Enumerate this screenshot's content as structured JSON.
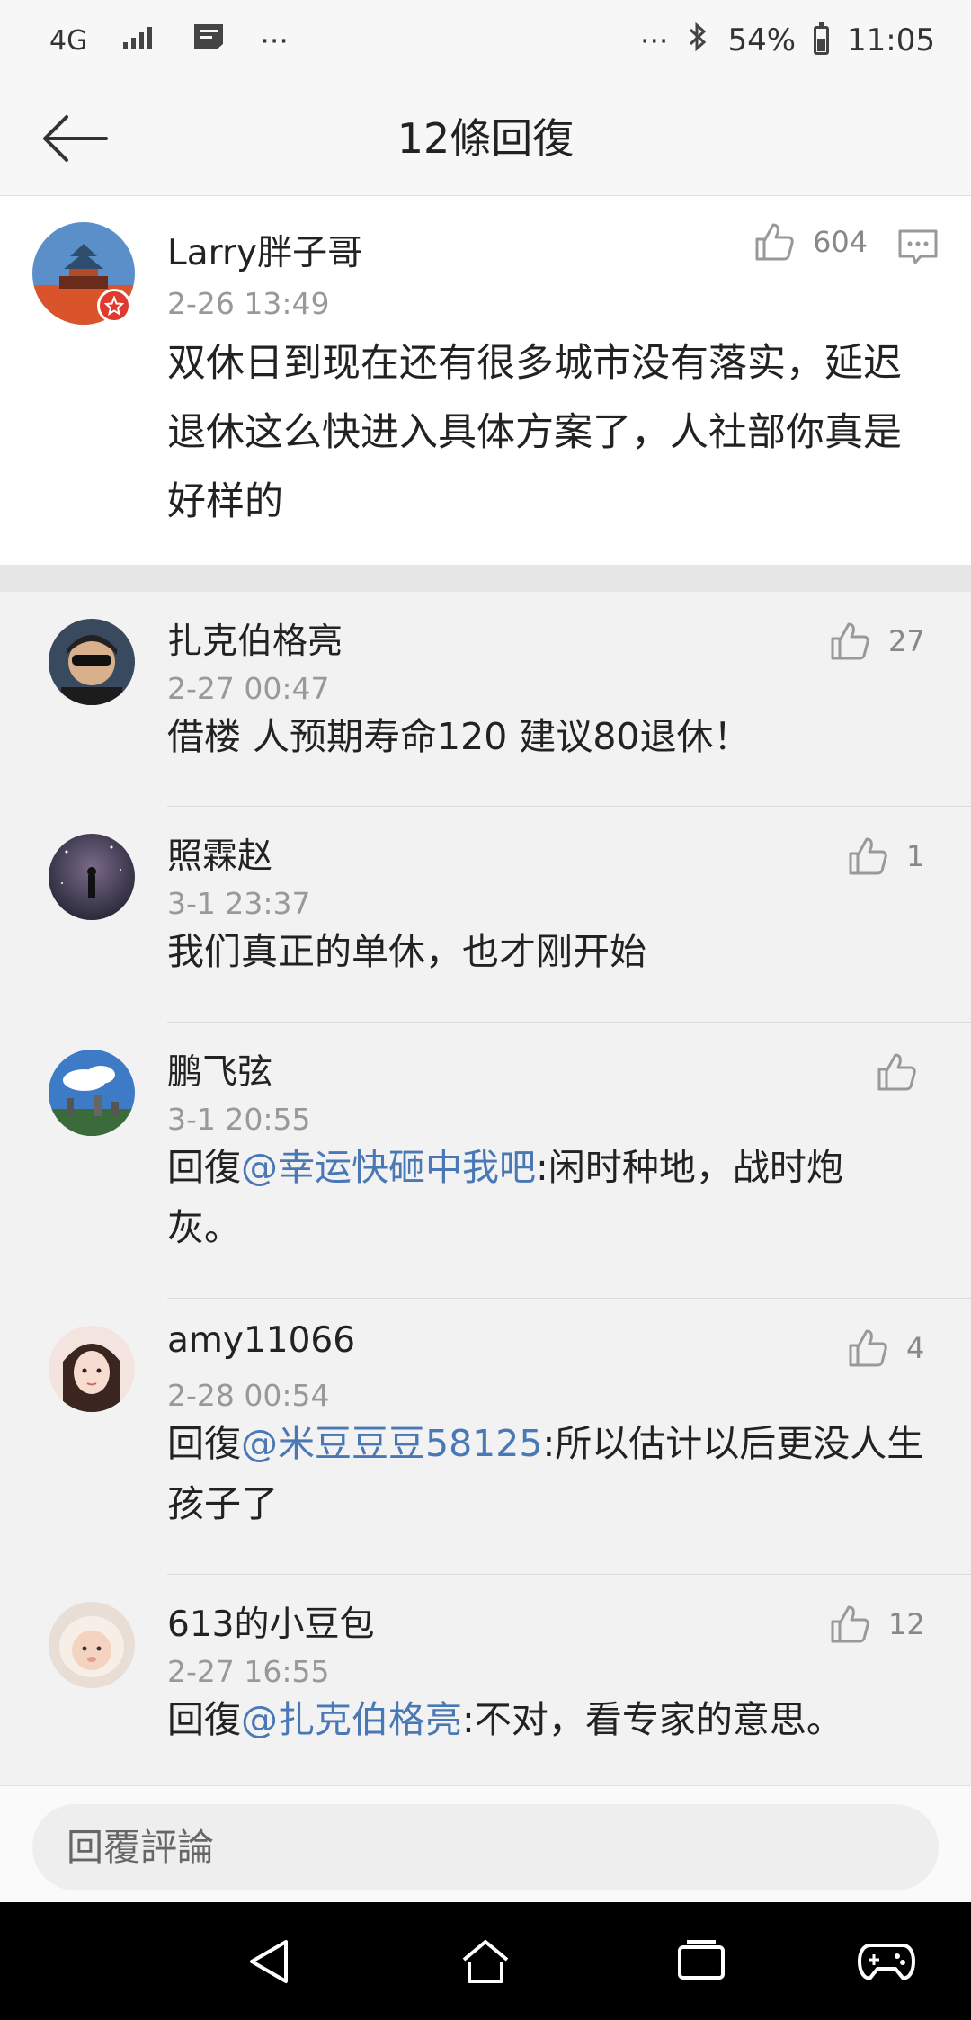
{
  "status_bar": {
    "network": "4G",
    "dots_left": "···",
    "dots_right": "···",
    "battery_percent": "54%",
    "battery_level": 0.54,
    "time": "11:05"
  },
  "nav": {
    "title": "12條回復"
  },
  "main_comment": {
    "author": "Larry胖子哥",
    "time": "2-26 13:49",
    "likes": "604",
    "content": "双休日到现在还有很多城市没有落实，延迟退休这么快进入具体方案了，人社部你真是好样的"
  },
  "replies": [
    {
      "author": "扎克伯格亮",
      "time": "2-27 00:47",
      "likes": "27",
      "prefix": "",
      "mention": "",
      "content": "借楼 人预期寿命120 建议80退休！"
    },
    {
      "author": "照霖赵",
      "time": "3-1 23:37",
      "likes": "1",
      "prefix": "",
      "mention": "",
      "content": "我们真正的单休，也才刚开始"
    },
    {
      "author": "鹏飞弦",
      "time": "3-1 20:55",
      "likes": "",
      "prefix": "回復",
      "mention": "@幸运快砸中我吧",
      "content": ":闲时种地，战时炮灰。"
    },
    {
      "author": "amy11066",
      "time": "2-28 00:54",
      "likes": "4",
      "prefix": "回復",
      "mention": "@米豆豆豆58125",
      "content": ":所以估计以后更没人生孩子了"
    },
    {
      "author": "613的小豆包",
      "time": "2-27 16:55",
      "likes": "12",
      "prefix": "回復",
      "mention": "@扎克伯格亮",
      "content": ":不对，看专家的意思。"
    }
  ],
  "input": {
    "placeholder": "回覆評論"
  },
  "colors": {
    "mention": "#4a78b5",
    "background": "#f2f2f2",
    "card": "#ffffff"
  },
  "icons": [
    "back-arrow-icon",
    "thumbs-up-icon",
    "comment-icon",
    "bluetooth-icon",
    "signal-icon",
    "message-icon",
    "battery-icon",
    "nav-back-icon",
    "nav-home-icon",
    "nav-recents-icon",
    "game-icon"
  ]
}
